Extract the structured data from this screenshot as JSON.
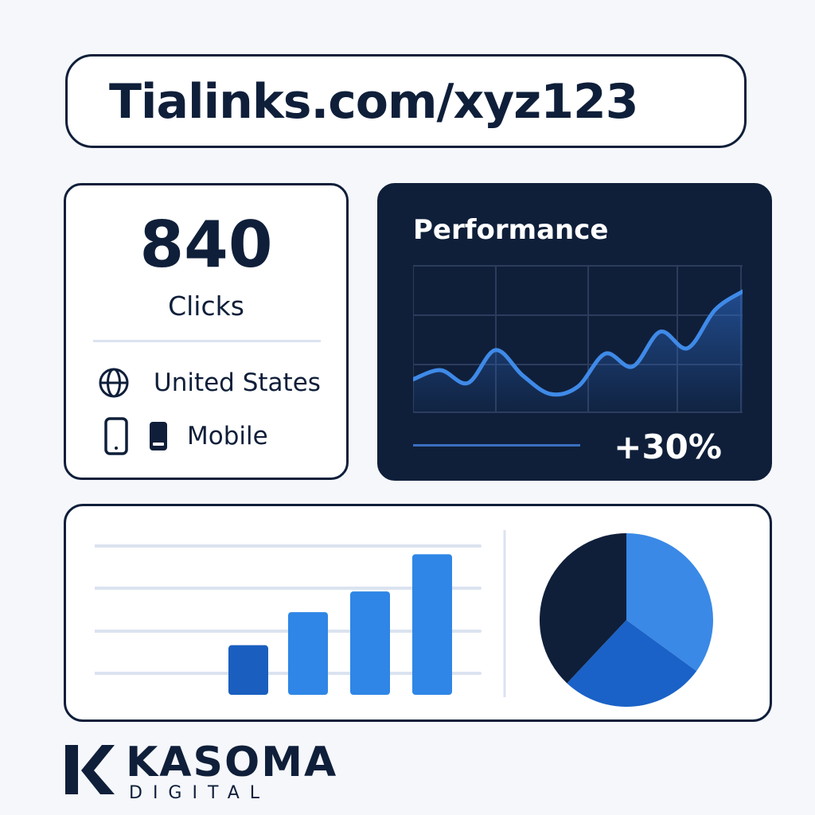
{
  "url_bar": {
    "text": "Tialinks.com/xyz123"
  },
  "stats": {
    "clicks_value": "840",
    "clicks_label": "Clicks",
    "country_label": "United States",
    "device_label": "Mobile",
    "icons": [
      "globe-icon",
      "phone-icon",
      "phone-small-icon"
    ]
  },
  "performance": {
    "title": "Performance",
    "change": "+30%",
    "colors": {
      "background": "#0f1f3a",
      "line": "#3f8ae8",
      "grid": "#2b3c5c"
    }
  },
  "chart_data": [
    {
      "type": "line",
      "title": "Performance",
      "x": [
        0,
        1,
        2,
        3,
        4,
        5,
        6,
        7,
        8,
        9,
        10,
        11,
        12
      ],
      "series": [
        {
          "values": [
            1.8,
            2.3,
            1.6,
            3.4,
            2.0,
            1.0,
            1.4,
            3.2,
            2.5,
            4.4,
            3.5,
            5.6,
            6.6
          ]
        }
      ],
      "ylim": [
        0,
        8
      ],
      "grid": true
    },
    {
      "type": "bar",
      "categories": [
        "",
        "",
        "",
        ""
      ],
      "values": [
        1.2,
        2.0,
        2.5,
        3.4
      ],
      "ylim": [
        0,
        3.6
      ],
      "grid": true,
      "colors": [
        "#1a5fbf",
        "#2f86e6",
        "#2f86e6",
        "#2f86e6"
      ]
    },
    {
      "type": "pie",
      "values": [
        35,
        27,
        38
      ],
      "colors": [
        "#3a89e6",
        "#1a62c7",
        "#0f1f3a"
      ]
    }
  ],
  "brand": {
    "name": "KASOMA",
    "tagline": "DIGITAL"
  }
}
